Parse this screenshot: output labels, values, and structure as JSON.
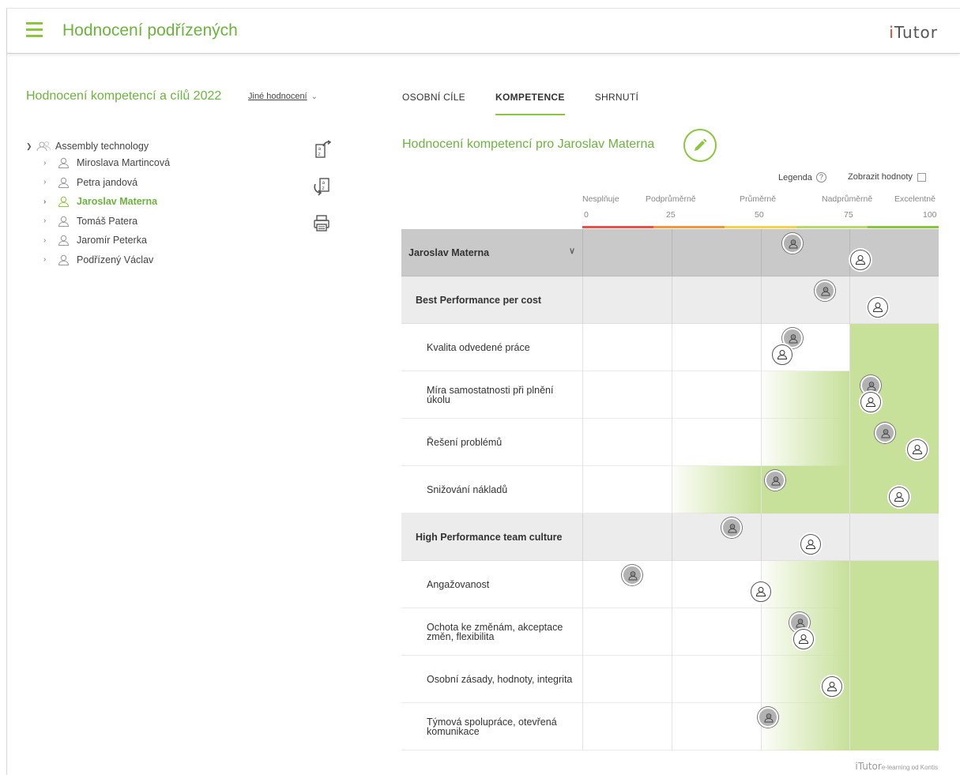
{
  "header": {
    "title": "Hodnocení podřízených",
    "brand_i": "i",
    "brand_tutor": "Tutor"
  },
  "evaluation": {
    "title": "Hodnocení kompetencí a cílů 2022",
    "other_link": "Jiné hodnocení"
  },
  "tree": {
    "root": "Assembly technology",
    "items": [
      {
        "label": "Miroslava Martincová",
        "active": false
      },
      {
        "label": "Petra jandová",
        "active": false
      },
      {
        "label": "Jaroslav Materna",
        "active": true
      },
      {
        "label": "Tomáš Patera",
        "active": false
      },
      {
        "label": "Jaromír Peterka",
        "active": false
      },
      {
        "label": " Podřízený Václav",
        "active": false
      }
    ]
  },
  "tabs": [
    {
      "label": "OSOBNÍ CÍLE",
      "active": false
    },
    {
      "label": "KOMPETENCE",
      "active": true
    },
    {
      "label": "SHRNUTÍ",
      "active": false
    }
  ],
  "section_title": "Hodnocení kompetencí pro Jaroslav Materna",
  "legend_label": "Legenda",
  "help_glyph": "?",
  "show_values_label": "Zobrazit hodnoty",
  "scale": {
    "levels": [
      "Nesplňuje",
      "Podprůměrně",
      "Průměrně",
      "Nadprůměrně",
      "Excelentně"
    ],
    "ticks": [
      "0",
      "25",
      "50",
      "75",
      "100"
    ],
    "colors": [
      "#e8504c",
      "#f0963c",
      "#f2d343",
      "#b9d86a",
      "#8cc63f"
    ]
  },
  "colors": {
    "accent": "#8cc63f",
    "band": "#c7e09a"
  },
  "rows": [
    {
      "kind": "top",
      "label": "Jaroslav Materna",
      "mgr": 59,
      "self": 78,
      "band": null
    },
    {
      "kind": "group",
      "label": "Best Performance per cost",
      "mgr": 68,
      "self": 83,
      "band": null
    },
    {
      "kind": "item",
      "label": "Kvalita odvedené práce",
      "mgr": 59,
      "self": 56,
      "band": [
        75,
        100,
        "solid"
      ]
    },
    {
      "kind": "item",
      "label": "Míra samostatnosti při plnění úkolu",
      "mgr": 81,
      "self": 81,
      "band": [
        50,
        100,
        "fade"
      ]
    },
    {
      "kind": "item",
      "label": "Řešení problémů",
      "mgr": 85,
      "self": 94,
      "band": [
        50,
        100,
        "fade"
      ]
    },
    {
      "kind": "item",
      "label": "Snižování nákladů",
      "mgr": 54,
      "self": 89,
      "band": [
        25,
        100,
        "fade"
      ]
    },
    {
      "kind": "group",
      "label": "High Performance team culture",
      "mgr": 42,
      "self": 64,
      "band": null
    },
    {
      "kind": "item",
      "label": "Angažovanost",
      "mgr": 14,
      "self": 50,
      "band": [
        50,
        100,
        "fade"
      ]
    },
    {
      "kind": "item",
      "label": "Ochota ke změnám, akceptace změn, flexibilita",
      "mgr": 61,
      "self": 62,
      "band": [
        50,
        100,
        "fade"
      ]
    },
    {
      "kind": "item",
      "label": "Osobní zásady, hodnoty, integrita",
      "mgr": null,
      "self": 70,
      "band": [
        50,
        100,
        "fade"
      ]
    },
    {
      "kind": "item",
      "label": "Týmová spolupráce, otevřená komunikace",
      "mgr": 52,
      "self": null,
      "band": [
        50,
        100,
        "fade"
      ]
    }
  ],
  "footer": {
    "brand": "iTutor",
    "tagline": "e-learning od Kontis"
  }
}
